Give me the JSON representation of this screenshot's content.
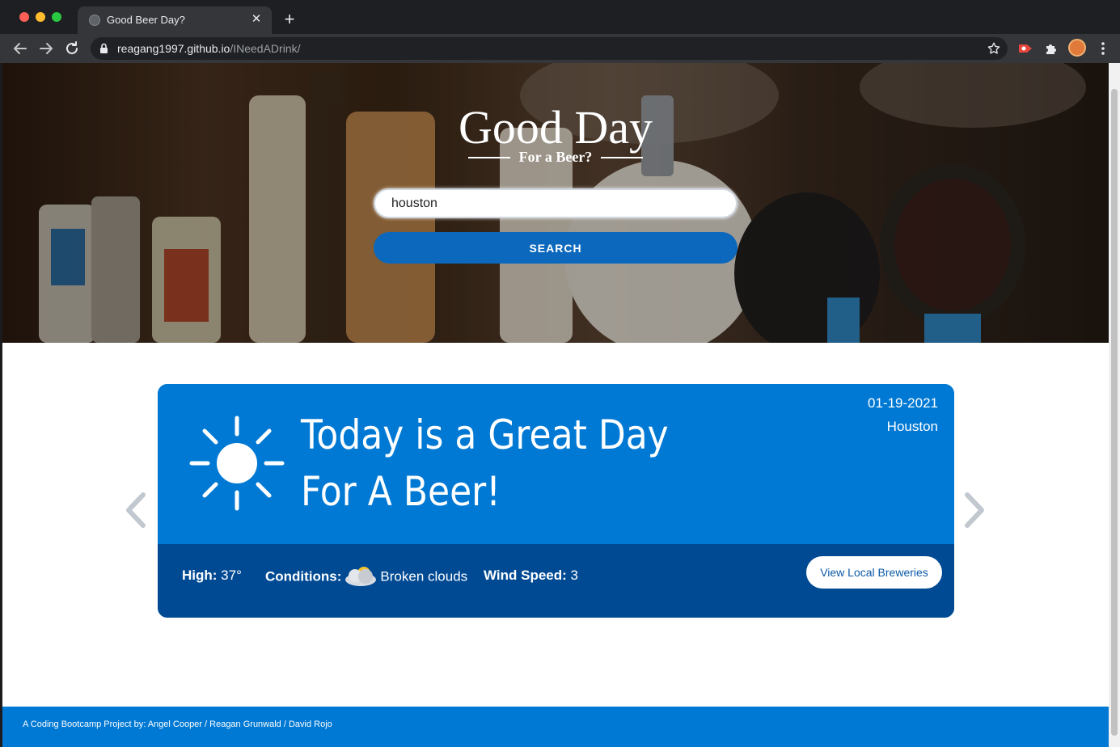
{
  "browser": {
    "tab_title": "Good Beer Day?",
    "tab_close": "✕",
    "new_tab": "+",
    "url_host": "reagang1997.github.io",
    "url_path": "/INeedADrink/"
  },
  "hero": {
    "logo_title": "Good Day",
    "logo_subtitle": "For a Beer?",
    "search_value": "houston",
    "search_button": "SEARCH"
  },
  "weather": {
    "headline": "Today is a Great Day For A Beer!",
    "date": "01-19-2021",
    "city": "Houston",
    "icon": "sun-icon",
    "high_label": "High:",
    "high_value": " 37°",
    "conditions_label": "Conditions:",
    "conditions_value": "Broken clouds",
    "conditions_icon": "broken-clouds-icon",
    "wind_label": "Wind Speed:",
    "wind_value": " 3",
    "breweries_button": "View Local Breweries"
  },
  "footer": {
    "text": "A Coding Bootcamp Project by: Angel Cooper / Reagan Grunwald / David Rojo"
  },
  "colors": {
    "card_top": "#0079d4",
    "card_bottom": "#004a94",
    "search_button": "#0b68bd",
    "footer": "#0079d4"
  }
}
